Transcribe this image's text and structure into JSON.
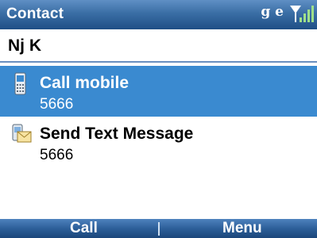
{
  "titlebar": {
    "title": "Contact",
    "network_indicator": "g e",
    "signal_icon": "signal-strength-icon"
  },
  "contact": {
    "name": "Nj K"
  },
  "actions": [
    {
      "label": "Call mobile",
      "detail": "5666",
      "icon": "mobile-phone-icon",
      "selected": true
    },
    {
      "label": "Send Text Message",
      "detail": "5666",
      "icon": "text-message-icon",
      "selected": false
    }
  ],
  "softkeys": {
    "left": "Call",
    "right": "Menu"
  },
  "colors": {
    "titlebar": "#3a6ea5",
    "selection": "#3a8ad0",
    "softkey_bar": "#2d5f99"
  }
}
